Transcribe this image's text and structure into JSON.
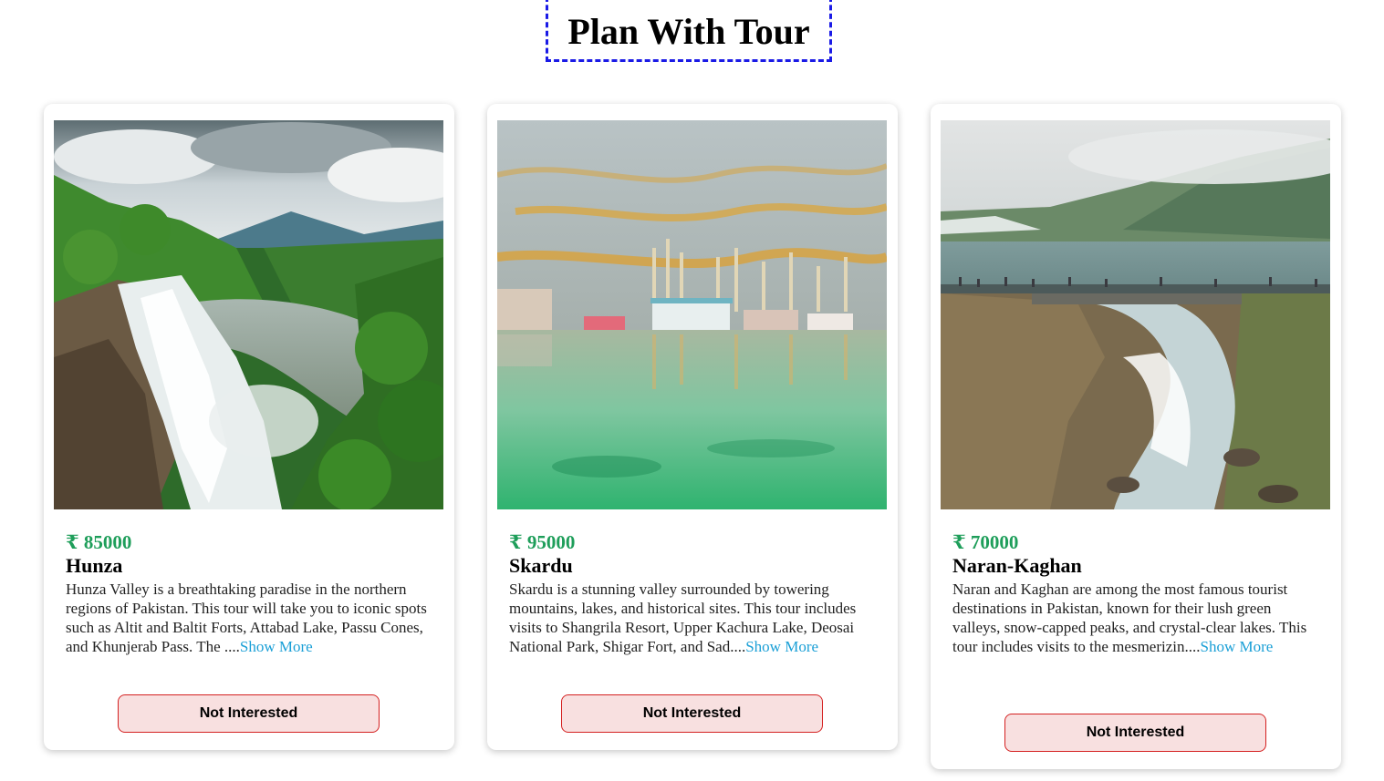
{
  "page": {
    "title": "Plan With Tour"
  },
  "tours": [
    {
      "price": "₹ 85000",
      "name": "Hunza",
      "description": "Hunza Valley is a breathtaking paradise in the northern regions of Pakistan. This tour will take you to iconic spots such as Altit and Baltit Forts, Attabad Lake, Passu Cones, and Khunjerab Pass. The ....",
      "show_more": "Show More",
      "button": "Not Interested",
      "image": "waterfall-photo"
    },
    {
      "price": "₹ 95000",
      "name": "Skardu",
      "description": "Skardu is a stunning valley surrounded by towering mountains, lakes, and historical sites. This tour includes visits to Shangrila Resort, Upper Kachura Lake, Deosai National Park, Shigar Fort, and Sad....",
      "show_more": "Show More",
      "button": "Not Interested",
      "image": "lake-resort-photo"
    },
    {
      "price": "₹ 70000",
      "name": "Naran-Kaghan",
      "description": "Naran and Kaghan are among the most famous tourist destinations in Pakistan, known for their lush green valleys, snow-capped peaks, and crystal-clear lakes. This tour includes visits to the mesmerizin....",
      "show_more": "Show More",
      "button": "Not Interested",
      "image": "mountain-lake-photo"
    }
  ],
  "colors": {
    "price": "#1e9e5a",
    "link": "#1a9fd6",
    "button_bg": "#f8e0e0",
    "button_border": "#d42020",
    "title_border": "#1a1ae6"
  }
}
